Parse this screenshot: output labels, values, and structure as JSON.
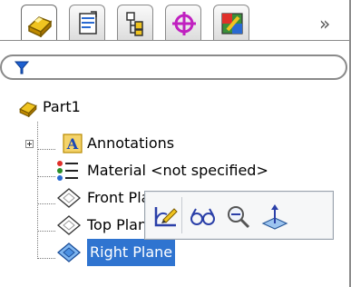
{
  "tabs": [
    {
      "name": "feature-manager",
      "active": true
    },
    {
      "name": "property-manager",
      "active": false
    },
    {
      "name": "configuration-manager",
      "active": false
    },
    {
      "name": "dimxpert-manager",
      "active": false
    },
    {
      "name": "display-manager",
      "active": false
    }
  ],
  "more_label": "»",
  "tree": {
    "root": "Part1",
    "items": [
      {
        "label": "Annotations",
        "icon": "annotations-icon"
      },
      {
        "label": "Material <not specified>",
        "icon": "material-icon"
      },
      {
        "label": "Front Plane",
        "icon": "plane-icon"
      },
      {
        "label": "Top Plane",
        "icon": "plane-icon"
      },
      {
        "label": "Right Plane",
        "icon": "plane-icon",
        "selected": true
      }
    ]
  },
  "context_toolbar": {
    "buttons": [
      "edit-sketch-icon",
      "show-icon",
      "zoom-to-selection-icon",
      "normal-to-icon"
    ]
  },
  "colors": {
    "selection": "#2f74d0",
    "part_icon": "#e3b514",
    "dimxpert": "#c020c0"
  }
}
